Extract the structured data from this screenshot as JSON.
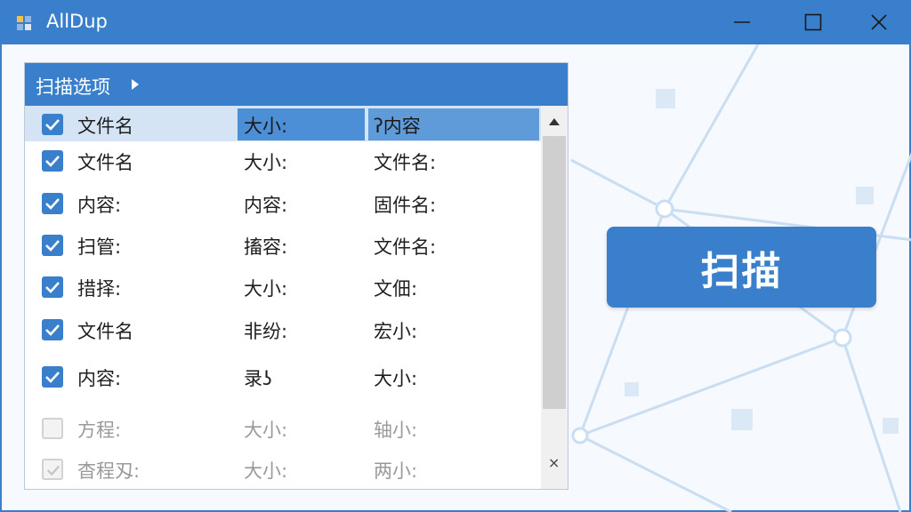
{
  "window": {
    "title": "AllDup",
    "icons": {
      "app": "alldup-icon",
      "minimize": "minimize-icon",
      "maximize": "maximize-icon",
      "close": "close-icon"
    }
  },
  "options_panel": {
    "title": "扫描选项",
    "rows": [
      {
        "checked": true,
        "enabled": true,
        "selected": true,
        "col1": "文件名",
        "col2": "大小:",
        "col3": "ʔ内容"
      },
      {
        "checked": true,
        "enabled": true,
        "selected": false,
        "col1": "文件名",
        "col2": "大小:",
        "col3": "文件名:"
      },
      {
        "checked": true,
        "enabled": true,
        "selected": false,
        "col1": "内容:",
        "col2": "内容:",
        "col3": "固件名:"
      },
      {
        "checked": true,
        "enabled": true,
        "selected": false,
        "col1": "扫管:",
        "col2": "搐容:",
        "col3": "文件名:"
      },
      {
        "checked": true,
        "enabled": true,
        "selected": false,
        "col1": "措择:",
        "col2": "大小:",
        "col3": "文佃:"
      },
      {
        "checked": true,
        "enabled": true,
        "selected": false,
        "col1": "文件名",
        "col2": "非纷:",
        "col3": "宏小:"
      },
      {
        "checked": true,
        "enabled": true,
        "selected": false,
        "col1": "内容:",
        "col2": "录ʖ",
        "col3": "大小:"
      },
      {
        "checked": false,
        "enabled": false,
        "selected": false,
        "col1": "方程:",
        "col2": "大小:",
        "col3": "轴小:"
      },
      {
        "checked": true,
        "enabled": false,
        "selected": false,
        "col1": "杳程刄:",
        "col2": "大小:",
        "col3": "两小:"
      }
    ],
    "scrollbar": {
      "up_icon": "scroll-up-icon",
      "close_glyph": "×"
    }
  },
  "scan_button": {
    "label": "扫描"
  },
  "colors": {
    "accent": "#3a7fcb",
    "selection": "#d4e4f5",
    "background": "#eaf3fb"
  }
}
